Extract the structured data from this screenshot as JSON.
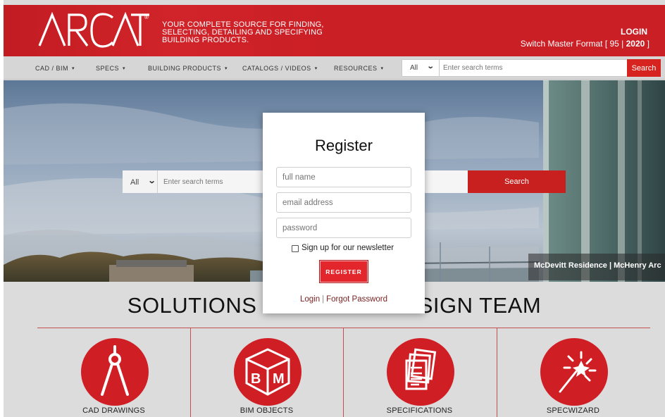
{
  "header": {
    "logo_text": "ARCAT",
    "registered_mark": "®",
    "tagline": [
      "YOUR COMPLETE SOURCE FOR FINDING,",
      "SELECTING, DETAILING AND SPECIFYING",
      "BUILDING PRODUCTS."
    ],
    "login_label": "LOGIN",
    "master_format_prefix": "Switch Master Format [ 95 | ",
    "master_format_active": "2020",
    "master_format_suffix": " ]"
  },
  "nav": {
    "items": [
      {
        "label": "CAD / BIM"
      },
      {
        "label": "SPECS"
      },
      {
        "label": "BUILDING PRODUCTS"
      },
      {
        "label": "CATALOGS / VIDEOS"
      },
      {
        "label": "RESOURCES"
      }
    ],
    "caret": "▾",
    "search": {
      "scope": "All",
      "placeholder": "Enter search terms",
      "button_label": "Search"
    }
  },
  "hero": {
    "search": {
      "scope": "All",
      "placeholder": "Enter search terms",
      "button_label": "Search"
    },
    "caption": "McDevitt Residence | McHenry Arc"
  },
  "solutions": {
    "title": "SOLUTIONS FOR YOUR DESIGN TEAM",
    "items": [
      {
        "label": "CAD DRAWINGS",
        "icon": "compass-icon"
      },
      {
        "label": "BIM OBJECTS",
        "icon": "bim-cube-icon"
      },
      {
        "label": "SPECIFICATIONS",
        "icon": "documents-icon"
      },
      {
        "label": "SPECWIZARD",
        "icon": "magic-wand-icon"
      }
    ]
  },
  "modal": {
    "title": "Register",
    "full_name_placeholder": "full name",
    "email_placeholder": "email address",
    "password_placeholder": "password",
    "newsletter_label": "Sign up for our newsletter",
    "register_label": "REGISTER",
    "login_link": "Login",
    "separator": "|",
    "forgot_link": "Forgot Password"
  },
  "colors": {
    "brand_red": "#cb1f26",
    "button_red": "#e3262b",
    "link_red": "#7a2323"
  }
}
